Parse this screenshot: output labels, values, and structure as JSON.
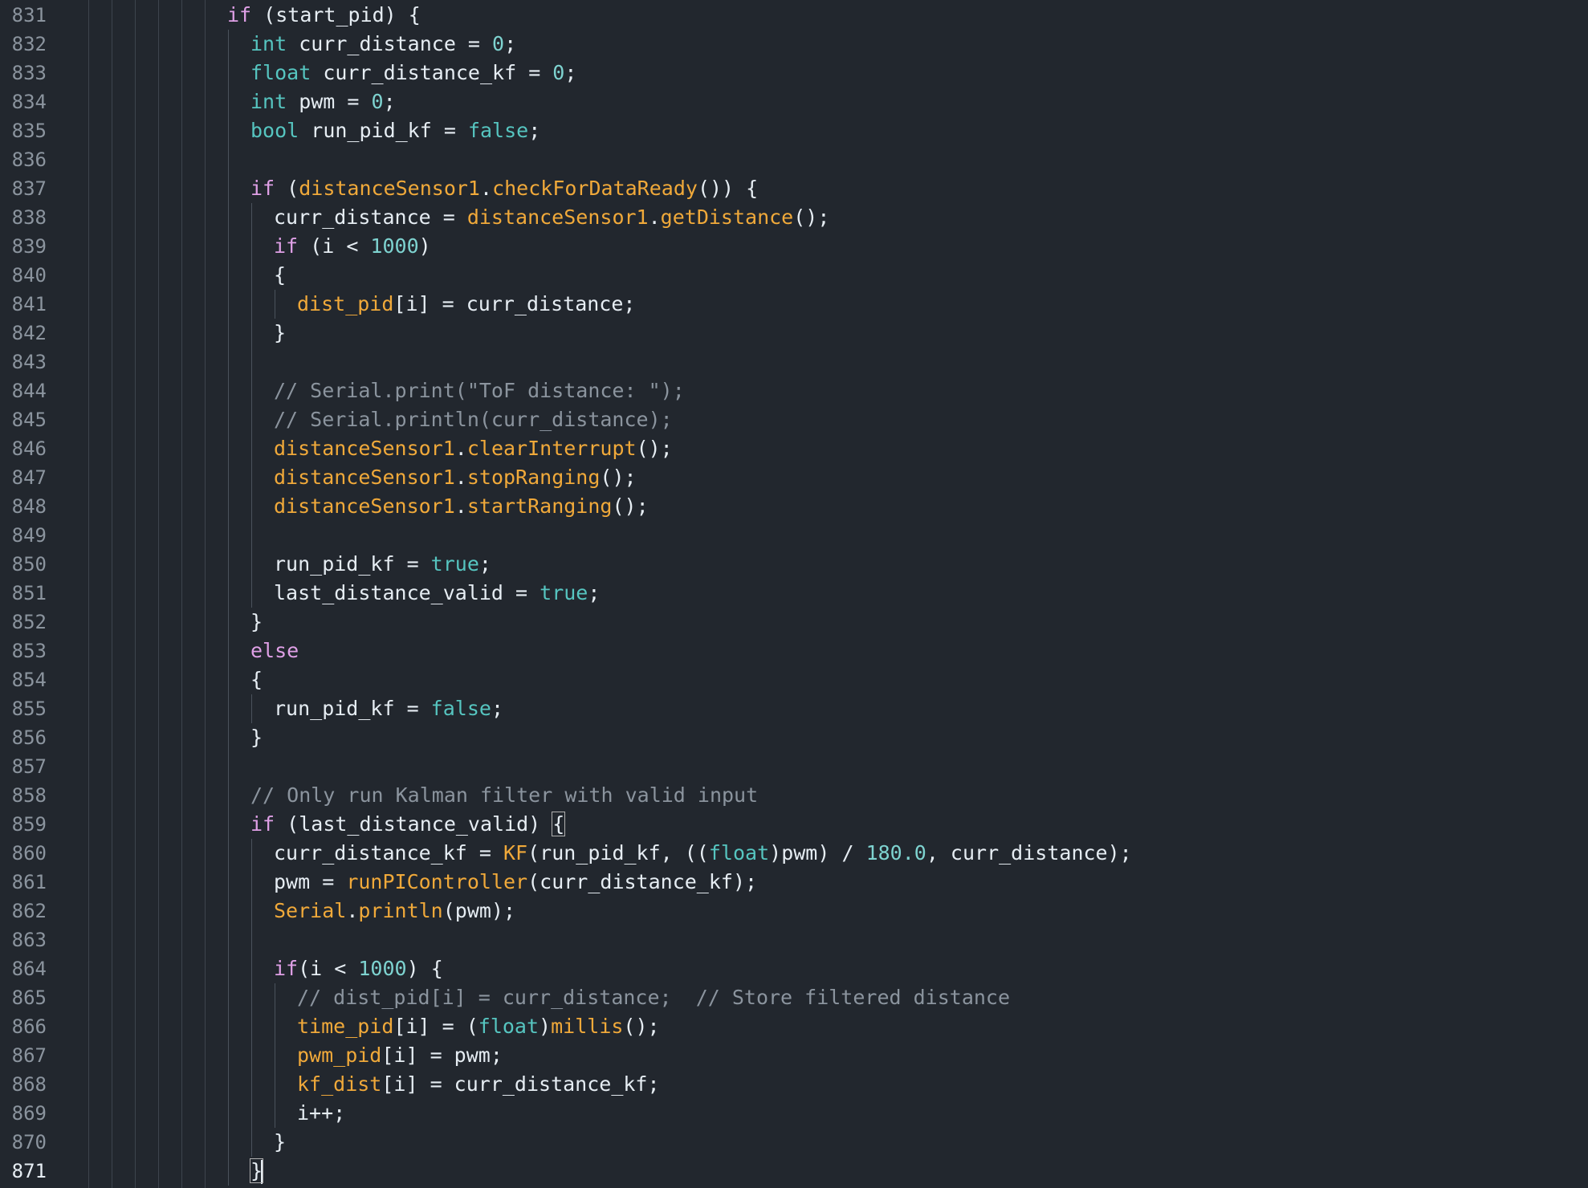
{
  "editor": {
    "active_line": "871",
    "lines": [
      {
        "no": "831",
        "tokens": [
          [
            "kw",
            "if"
          ],
          [
            "pl",
            " (start_pid) {"
          ]
        ]
      },
      {
        "no": "832",
        "tokens": [
          [
            "ty",
            "int"
          ],
          [
            "pl",
            " curr_distance = "
          ],
          [
            "num",
            "0"
          ],
          [
            "pl",
            ";"
          ]
        ]
      },
      {
        "no": "833",
        "tokens": [
          [
            "ty",
            "float"
          ],
          [
            "pl",
            " curr_distance_kf = "
          ],
          [
            "num",
            "0"
          ],
          [
            "pl",
            ";"
          ]
        ]
      },
      {
        "no": "834",
        "tokens": [
          [
            "ty",
            "int"
          ],
          [
            "pl",
            " pwm = "
          ],
          [
            "num",
            "0"
          ],
          [
            "pl",
            ";"
          ]
        ]
      },
      {
        "no": "835",
        "tokens": [
          [
            "ty",
            "bool"
          ],
          [
            "pl",
            " run_pid_kf = "
          ],
          [
            "ty",
            "false"
          ],
          [
            "pl",
            ";"
          ]
        ]
      },
      {
        "no": "836",
        "tokens": []
      },
      {
        "no": "837",
        "tokens": [
          [
            "kw",
            "if"
          ],
          [
            "pl",
            " ("
          ],
          [
            "fn",
            "distanceSensor1"
          ],
          [
            "pl",
            "."
          ],
          [
            "fn",
            "checkForDataReady"
          ],
          [
            "pl",
            "()) {"
          ]
        ]
      },
      {
        "no": "838",
        "tokens": [
          [
            "pl",
            "curr_distance = "
          ],
          [
            "fn",
            "distanceSensor1"
          ],
          [
            "pl",
            "."
          ],
          [
            "fn",
            "getDistance"
          ],
          [
            "pl",
            "();"
          ]
        ]
      },
      {
        "no": "839",
        "tokens": [
          [
            "kw",
            "if"
          ],
          [
            "pl",
            " (i < "
          ],
          [
            "num",
            "1000"
          ],
          [
            "pl",
            ")"
          ]
        ]
      },
      {
        "no": "840",
        "tokens": [
          [
            "pl",
            "{"
          ]
        ]
      },
      {
        "no": "841",
        "tokens": [
          [
            "fn",
            "dist_pid"
          ],
          [
            "pl",
            "[i] = curr_distance;"
          ]
        ]
      },
      {
        "no": "842",
        "tokens": [
          [
            "pl",
            "}"
          ]
        ]
      },
      {
        "no": "843",
        "tokens": []
      },
      {
        "no": "844",
        "tokens": [
          [
            "cm",
            "// Serial.print(\"ToF distance: \");"
          ]
        ]
      },
      {
        "no": "845",
        "tokens": [
          [
            "cm",
            "// Serial.println(curr_distance);"
          ]
        ]
      },
      {
        "no": "846",
        "tokens": [
          [
            "fn",
            "distanceSensor1"
          ],
          [
            "pl",
            "."
          ],
          [
            "fn",
            "clearInterrupt"
          ],
          [
            "pl",
            "();"
          ]
        ]
      },
      {
        "no": "847",
        "tokens": [
          [
            "fn",
            "distanceSensor1"
          ],
          [
            "pl",
            "."
          ],
          [
            "fn",
            "stopRanging"
          ],
          [
            "pl",
            "();"
          ]
        ]
      },
      {
        "no": "848",
        "tokens": [
          [
            "fn",
            "distanceSensor1"
          ],
          [
            "pl",
            "."
          ],
          [
            "fn",
            "startRanging"
          ],
          [
            "pl",
            "();"
          ]
        ]
      },
      {
        "no": "849",
        "tokens": []
      },
      {
        "no": "850",
        "tokens": [
          [
            "pl",
            "run_pid_kf = "
          ],
          [
            "ty",
            "true"
          ],
          [
            "pl",
            ";"
          ]
        ]
      },
      {
        "no": "851",
        "tokens": [
          [
            "pl",
            "last_distance_valid = "
          ],
          [
            "ty",
            "true"
          ],
          [
            "pl",
            ";"
          ]
        ]
      },
      {
        "no": "852",
        "tokens": [
          [
            "pl",
            "}"
          ]
        ]
      },
      {
        "no": "853",
        "tokens": [
          [
            "kw",
            "else"
          ]
        ]
      },
      {
        "no": "854",
        "tokens": [
          [
            "pl",
            "{"
          ]
        ]
      },
      {
        "no": "855",
        "tokens": [
          [
            "pl",
            "run_pid_kf = "
          ],
          [
            "ty",
            "false"
          ],
          [
            "pl",
            ";"
          ]
        ]
      },
      {
        "no": "856",
        "tokens": [
          [
            "pl",
            "}"
          ]
        ]
      },
      {
        "no": "857",
        "tokens": []
      },
      {
        "no": "858",
        "tokens": [
          [
            "cm",
            "// Only run Kalman filter with valid input"
          ]
        ]
      },
      {
        "no": "859",
        "tokens": [
          [
            "kw",
            "if"
          ],
          [
            "pl",
            " (last_distance_valid) "
          ],
          [
            "box",
            "{"
          ]
        ]
      },
      {
        "no": "860",
        "tokens": [
          [
            "pl",
            "curr_distance_kf = "
          ],
          [
            "fn",
            "KF"
          ],
          [
            "pl",
            "(run_pid_kf, (("
          ],
          [
            "ty",
            "float"
          ],
          [
            "pl",
            ")pwm) / "
          ],
          [
            "num",
            "180.0"
          ],
          [
            "pl",
            ", curr_distance);"
          ]
        ]
      },
      {
        "no": "861",
        "tokens": [
          [
            "pl",
            "pwm = "
          ],
          [
            "fn",
            "runPIController"
          ],
          [
            "pl",
            "(curr_distance_kf);"
          ]
        ]
      },
      {
        "no": "862",
        "tokens": [
          [
            "fn",
            "Serial"
          ],
          [
            "pl",
            "."
          ],
          [
            "fn",
            "println"
          ],
          [
            "pl",
            "(pwm);"
          ]
        ]
      },
      {
        "no": "863",
        "tokens": []
      },
      {
        "no": "864",
        "tokens": [
          [
            "kw",
            "if"
          ],
          [
            "pl",
            "(i < "
          ],
          [
            "num",
            "1000"
          ],
          [
            "pl",
            ") {"
          ]
        ]
      },
      {
        "no": "865",
        "tokens": [
          [
            "cm",
            "// dist_pid[i] = curr_distance;  // Store filtered distance"
          ]
        ]
      },
      {
        "no": "866",
        "tokens": [
          [
            "fn",
            "time_pid"
          ],
          [
            "pl",
            "[i] = ("
          ],
          [
            "ty",
            "float"
          ],
          [
            "pl",
            ")"
          ],
          [
            "fn",
            "millis"
          ],
          [
            "pl",
            "();"
          ]
        ]
      },
      {
        "no": "867",
        "tokens": [
          [
            "fn",
            "pwm_pid"
          ],
          [
            "pl",
            "[i] = pwm;"
          ]
        ]
      },
      {
        "no": "868",
        "tokens": [
          [
            "fn",
            "kf_dist"
          ],
          [
            "pl",
            "[i] = curr_distance_kf;"
          ]
        ]
      },
      {
        "no": "869",
        "tokens": [
          [
            "pl",
            "i++;"
          ]
        ]
      },
      {
        "no": "870",
        "tokens": [
          [
            "pl",
            "}"
          ]
        ]
      },
      {
        "no": "871",
        "tokens": [
          [
            "box",
            "}"
          ],
          [
            "caret",
            ""
          ]
        ]
      }
    ]
  }
}
